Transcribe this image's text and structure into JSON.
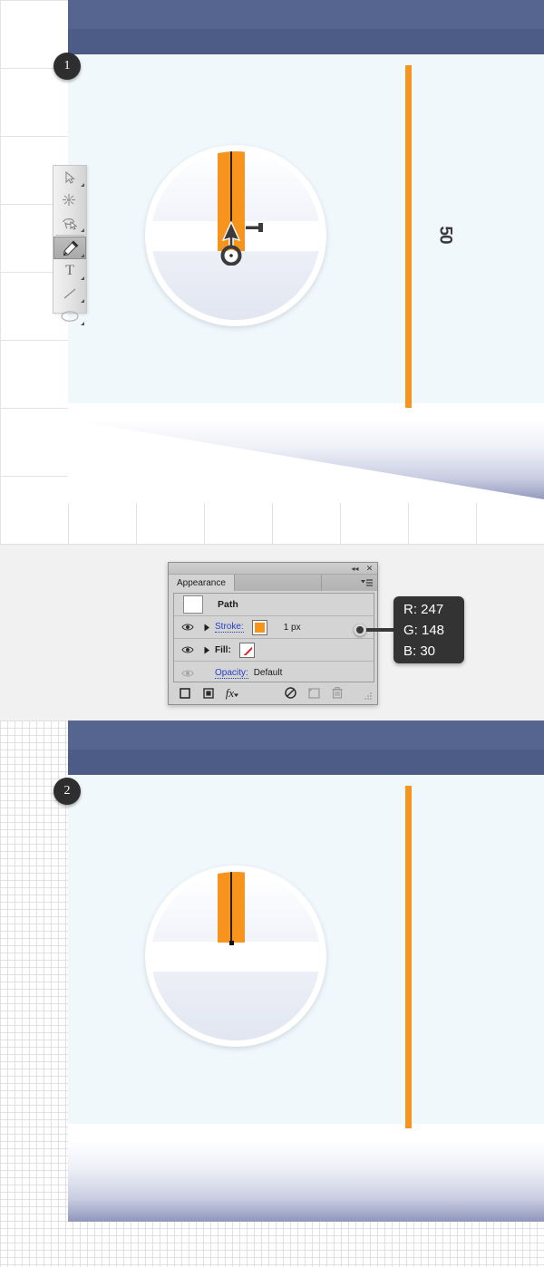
{
  "steps": [
    {
      "badge": "1"
    },
    {
      "badge": "2"
    }
  ],
  "canvas": {
    "ruler_label": "50",
    "stroke_color": "#f7941e",
    "header_color": "#566490",
    "header_lower_color": "#4d5b87",
    "body_color": "#f0f8fc"
  },
  "toolbar": {
    "tools": [
      {
        "name": "selection-tool",
        "glyph": "selection"
      },
      {
        "name": "magic-wand-tool",
        "glyph": "wand"
      },
      {
        "name": "lasso-tool",
        "glyph": "lasso"
      },
      {
        "name": "pen-tool",
        "glyph": "pen",
        "selected": true
      },
      {
        "name": "type-tool",
        "glyph": "T"
      },
      {
        "name": "line-segment-tool",
        "glyph": "line"
      },
      {
        "name": "ellipse-tool",
        "glyph": "ellipse"
      }
    ]
  },
  "appearance_panel": {
    "titlebar": {
      "collapse_label": "◂◂",
      "close_label": "✕"
    },
    "tab_active": "Appearance",
    "tab_inactive": "",
    "rows": [
      {
        "id": "path",
        "label": "Path",
        "type": "header"
      },
      {
        "id": "stroke",
        "label": "Stroke:",
        "value": "1 px",
        "swatch": "#f7941e",
        "visible": true
      },
      {
        "id": "fill",
        "label": "Fill:",
        "value": "",
        "swatch": "none",
        "visible": true
      },
      {
        "id": "opacity",
        "label": "Opacity:",
        "value": "Default",
        "visible": false
      }
    ],
    "footer_buttons": [
      {
        "name": "add-new-stroke-button",
        "glyph": "square-outline"
      },
      {
        "name": "add-new-fill-button",
        "glyph": "square-filled"
      },
      {
        "name": "add-new-effect-button",
        "glyph": "fx"
      },
      {
        "name": "clear-appearance-button",
        "glyph": "circle-slash"
      },
      {
        "name": "duplicate-item-button",
        "glyph": "duplicate"
      },
      {
        "name": "delete-item-button",
        "glyph": "trash"
      }
    ]
  },
  "callout": {
    "r": "R: 247",
    "g": "G: 148",
    "b": "B: 30"
  }
}
